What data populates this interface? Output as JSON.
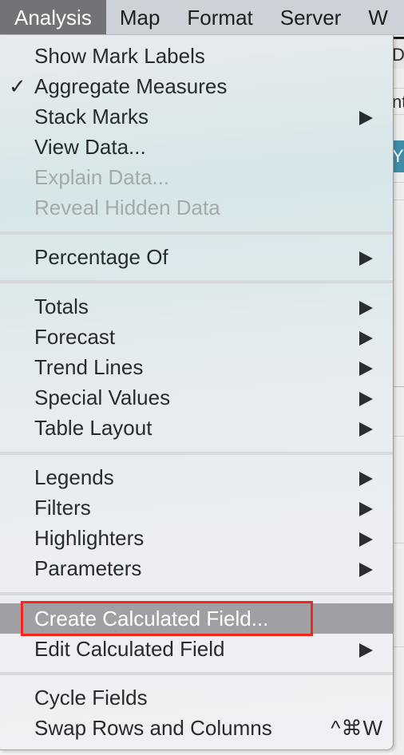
{
  "menubar": {
    "items": [
      {
        "label": "Analysis",
        "active": true
      },
      {
        "label": "Map"
      },
      {
        "label": "Format"
      },
      {
        "label": "Server"
      },
      {
        "label": "W"
      }
    ]
  },
  "background": {
    "cells": [
      "D-",
      "nt",
      "YO"
    ]
  },
  "menu": {
    "title": "Analysis",
    "items": [
      {
        "label": "Show Mark Labels"
      },
      {
        "label": "Aggregate Measures",
        "checked": true,
        "check_icon": "✓"
      },
      {
        "label": "Stack Marks",
        "submenu": true
      },
      {
        "label": "View Data..."
      },
      {
        "label": "Explain Data...",
        "disabled": true
      },
      {
        "label": "Reveal Hidden Data",
        "disabled": true
      },
      {
        "label": "Percentage Of",
        "submenu": true
      },
      {
        "label": "Totals",
        "submenu": true
      },
      {
        "label": "Forecast",
        "submenu": true
      },
      {
        "label": "Trend Lines",
        "submenu": true
      },
      {
        "label": "Special Values",
        "submenu": true
      },
      {
        "label": "Table Layout",
        "submenu": true
      },
      {
        "label": "Legends",
        "submenu": true
      },
      {
        "label": "Filters",
        "submenu": true
      },
      {
        "label": "Highlighters",
        "submenu": true
      },
      {
        "label": "Parameters",
        "submenu": true
      },
      {
        "label": "Create Calculated Field...",
        "highlighted": true
      },
      {
        "label": "Edit Calculated Field",
        "submenu": true
      },
      {
        "label": "Cycle Fields"
      },
      {
        "label": "Swap Rows and Columns",
        "shortcut": "^⌘W"
      }
    ]
  },
  "annotation": {
    "color": "#f2261c",
    "target": "Create Calculated Field..."
  },
  "colors": {
    "menubar_bg": "#cdd2d9",
    "menubar_active_bg": "#737277",
    "highlight_bg": "#a09fa4",
    "text": "#262b2e",
    "disabled_text": "#a4a9ad"
  }
}
